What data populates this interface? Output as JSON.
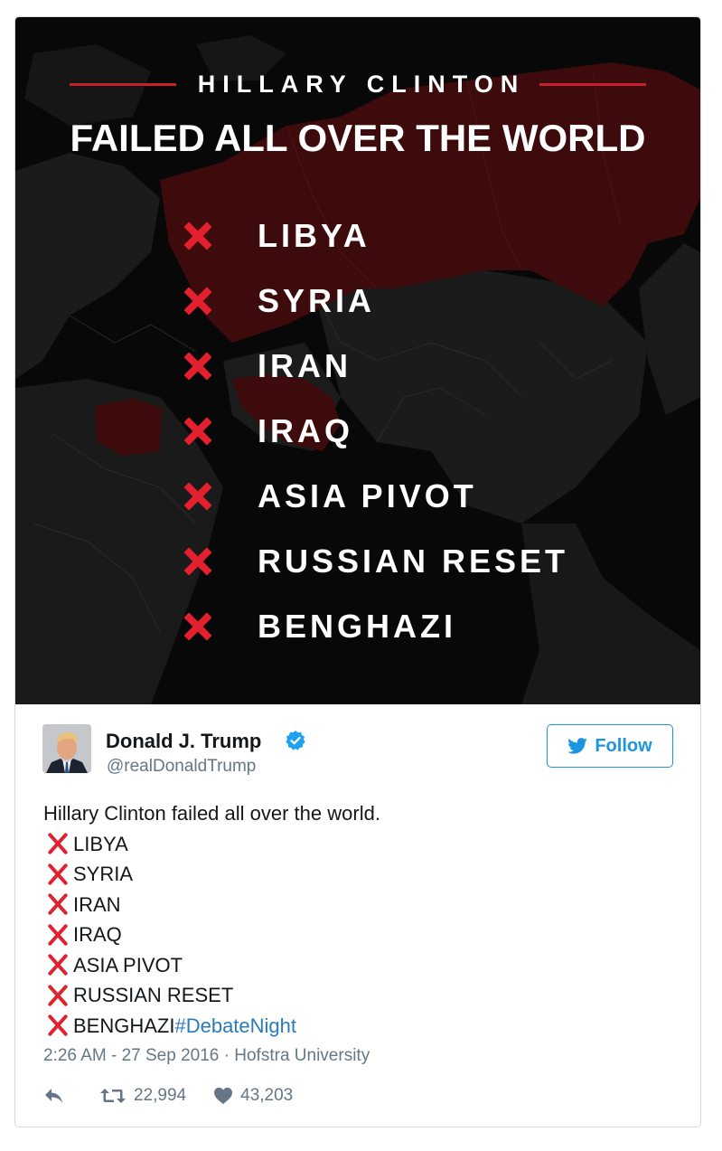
{
  "image": {
    "pre_title": "HILLARY CLINTON",
    "title": "FAILED ALL OVER THE WORLD",
    "items": [
      "LIBYA",
      "SYRIA",
      "IRAN",
      "IRAQ",
      "ASIA PIVOT",
      "RUSSIAN RESET",
      "BENGHAZI"
    ],
    "colors": {
      "accent_red": "#e3202e",
      "map_highlight": "#3e0b0d",
      "background": "#080808"
    }
  },
  "author": {
    "name": "Donald J. Trump",
    "handle": "@realDonaldTrump",
    "verified_icon": "verified-badge-icon"
  },
  "follow_button": {
    "label": "Follow",
    "icon": "twitter-bird-icon"
  },
  "tweet": {
    "intro": "Hillary Clinton failed all over the world.",
    "items": [
      "LIBYA",
      "SYRIA",
      "IRAN",
      "IRAQ",
      "ASIA PIVOT",
      "RUSSIAN RESET",
      "BENGHAZI"
    ],
    "hashtag": "#DebateNight",
    "emoji": "cross-mark-icon"
  },
  "meta": {
    "timestamp": "2:26 AM - 27 Sep 2016",
    "separator": "·",
    "location": "Hofstra University"
  },
  "actions": {
    "retweets": "22,994",
    "likes": "43,203"
  },
  "colors": {
    "link": "#2b7bb9",
    "follow": "#1b95e0",
    "muted": "#657786",
    "text": "#14171a"
  }
}
